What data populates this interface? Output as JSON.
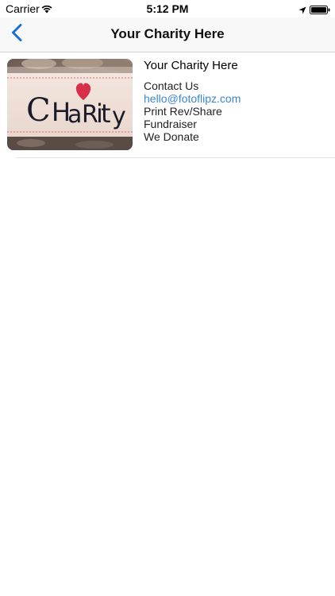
{
  "status_bar": {
    "carrier": "Carrier",
    "time": "5:12 PM",
    "icons": [
      "wifi-icon",
      "location-arrow-icon",
      "battery-icon"
    ]
  },
  "nav": {
    "title": "Your Charity Here",
    "back_icon": "chevron-left-icon",
    "accent_color": "#1a6fd6"
  },
  "charity": {
    "name": "Your Charity Here",
    "image_text": "CHARITY",
    "contact_label": "Contact Us",
    "email": "hello@fotoflipz.com",
    "line_print": "Print Rev/Share",
    "line_fundraiser": "Fundraiser",
    "line_donate": "We Donate",
    "link_color": "#3b87d2"
  }
}
